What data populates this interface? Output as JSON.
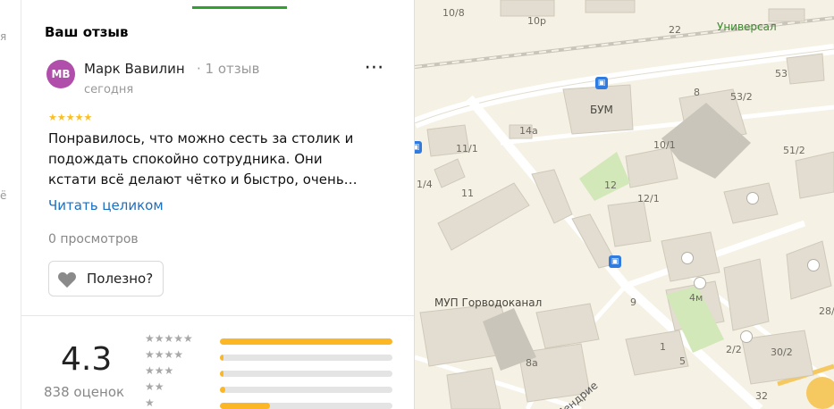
{
  "map": {
    "labels": [
      "10/8",
      "10р",
      "22",
      "Универсал",
      "53",
      "8",
      "53/2",
      "БУМ",
      "14а",
      "11/1",
      "10/1",
      "51/2",
      "1/4",
      "11",
      "12",
      "12/1",
      "9",
      "4м",
      "МУП Горводоканал",
      "28/",
      "1",
      "2/2",
      "30/2",
      "8а",
      "5",
      "32",
      "Пендрие"
    ]
  },
  "left_strip": {
    "letters": [
      "я",
      "ё"
    ]
  },
  "review": {
    "section_title": "Ваш отзыв",
    "avatar_initials": "MB",
    "avatar_color": "#b14dab",
    "author_name": "Марк Вавилин",
    "review_count": "· 1 отзыв",
    "date": "сегодня",
    "more_icon": "⋯",
    "stars": "★★★★★",
    "text": "Понравилось, что можно сесть за столик и подождать спокойно сотрудника. Они кстати всё делают чётко и быстро, очень…",
    "read_more": "Читать целиком",
    "views": "0 просмотров",
    "helpful_label": "Полезно?"
  },
  "summary": {
    "rating": "4.3",
    "count": "838 оценок",
    "distribution": [
      {
        "stars": "★★★★★",
        "fraction": 1.0
      },
      {
        "stars": "★★★★",
        "fraction": 0.02
      },
      {
        "stars": "★★★",
        "fraction": 0.02
      },
      {
        "stars": "★★",
        "fraction": 0.03
      },
      {
        "stars": "★",
        "fraction": 0.29
      }
    ]
  },
  "colors": {
    "accent_green": "#2fa12f",
    "link": "#1a6fc2",
    "star": "#fbbf24",
    "bar_fill": "#fbb724"
  }
}
